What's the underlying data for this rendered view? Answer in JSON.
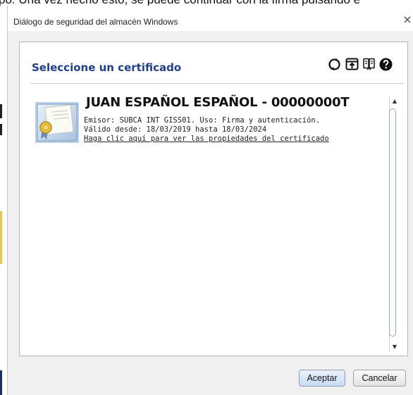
{
  "background": {
    "text": "po. Una vez hecho esto, se puede continuar con la firma pulsando e"
  },
  "dialog": {
    "title": "Diálogo de seguridad del almacén Windows",
    "close_glyph": "×",
    "heading": "Seleccione un certificado",
    "toolbar_icons": [
      "refresh-icon",
      "import-icon",
      "details-icon",
      "help-icon"
    ],
    "certificate": {
      "name": "JUAN ESPAÑOL ESPAÑOL - 00000000T",
      "issuer_line": "Emisor: SUBCA INT GISS01. Uso: Firma y autenticación.",
      "validity_line": "Válido desde: 18/03/2019 hasta 18/03/2024",
      "link_text": "Haga clic aquí para ver las propiedades del certificado"
    },
    "buttons": {
      "accept": "Aceptar",
      "cancel": "Cancelar"
    }
  },
  "colors": {
    "heading": "#1f3f8f",
    "accept_button": "#c9dbf5",
    "dialog_background": "#f0f0f0"
  }
}
